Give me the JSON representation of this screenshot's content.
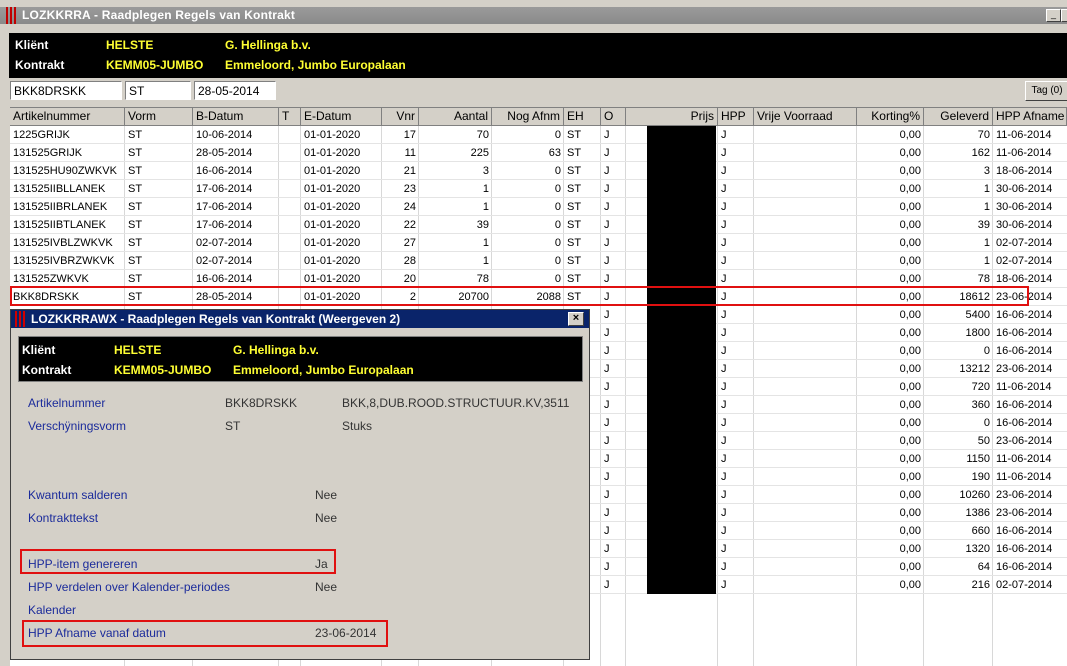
{
  "window": {
    "title": "LOZKKRRA - Raadplegen Regels van Kontrakt",
    "minimize_label": "_",
    "close_label": "×"
  },
  "header": {
    "klient_label": "Kliënt",
    "klient_code": "HELSTE",
    "klient_name": "G. Hellinga b.v.",
    "kontrakt_label": "Kontrakt",
    "kontrakt_code": "KEMM05-JUMBO",
    "kontrakt_desc": "Emmeloord, Jumbo Europalaan"
  },
  "filters": {
    "artikel": "BKK8DRSKK",
    "vorm": "ST",
    "datum": "28-05-2014",
    "tag_button": "Tag (0)"
  },
  "columns": [
    "Artikelnummer",
    "Vorm",
    "B-Datum",
    "T",
    "E-Datum",
    "Vnr",
    "Aantal",
    "Nog Afnm",
    "EH",
    "O",
    "Prijs",
    "HPP",
    "Vrije Voorraad",
    "Korting%",
    "Geleverd",
    "HPP Afname"
  ],
  "rows": [
    {
      "art": "1225GRIJK",
      "vorm": "ST",
      "bdat": "10-06-2014",
      "edat": "01-01-2020",
      "vnr": "17",
      "aantal": "70",
      "nog": "0",
      "eh": "ST",
      "o": "J",
      "hpp": "J",
      "korting": "0,00",
      "geleverd": "70",
      "afname": "11-06-2014"
    },
    {
      "art": "131525GRIJK",
      "vorm": "ST",
      "bdat": "28-05-2014",
      "edat": "01-01-2020",
      "vnr": "11",
      "aantal": "225",
      "nog": "63",
      "eh": "ST",
      "o": "J",
      "hpp": "J",
      "korting": "0,00",
      "geleverd": "162",
      "afname": "11-06-2014"
    },
    {
      "art": "131525HU90ZWKVK",
      "vorm": "ST",
      "bdat": "16-06-2014",
      "edat": "01-01-2020",
      "vnr": "21",
      "aantal": "3",
      "nog": "0",
      "eh": "ST",
      "o": "J",
      "hpp": "J",
      "korting": "0,00",
      "geleverd": "3",
      "afname": "18-06-2014"
    },
    {
      "art": "131525IIBLLANEK",
      "vorm": "ST",
      "bdat": "17-06-2014",
      "edat": "01-01-2020",
      "vnr": "23",
      "aantal": "1",
      "nog": "0",
      "eh": "ST",
      "o": "J",
      "hpp": "J",
      "korting": "0,00",
      "geleverd": "1",
      "afname": "30-06-2014"
    },
    {
      "art": "131525IIBRLANEK",
      "vorm": "ST",
      "bdat": "17-06-2014",
      "edat": "01-01-2020",
      "vnr": "24",
      "aantal": "1",
      "nog": "0",
      "eh": "ST",
      "o": "J",
      "hpp": "J",
      "korting": "0,00",
      "geleverd": "1",
      "afname": "30-06-2014"
    },
    {
      "art": "131525IIBTLANEK",
      "vorm": "ST",
      "bdat": "17-06-2014",
      "edat": "01-01-2020",
      "vnr": "22",
      "aantal": "39",
      "nog": "0",
      "eh": "ST",
      "o": "J",
      "hpp": "J",
      "korting": "0,00",
      "geleverd": "39",
      "afname": "30-06-2014"
    },
    {
      "art": "131525IVBLZWKVK",
      "vorm": "ST",
      "bdat": "02-07-2014",
      "edat": "01-01-2020",
      "vnr": "27",
      "aantal": "1",
      "nog": "0",
      "eh": "ST",
      "o": "J",
      "hpp": "J",
      "korting": "0,00",
      "geleverd": "1",
      "afname": "02-07-2014"
    },
    {
      "art": "131525IVBRZWKVK",
      "vorm": "ST",
      "bdat": "02-07-2014",
      "edat": "01-01-2020",
      "vnr": "28",
      "aantal": "1",
      "nog": "0",
      "eh": "ST",
      "o": "J",
      "hpp": "J",
      "korting": "0,00",
      "geleverd": "1",
      "afname": "02-07-2014"
    },
    {
      "art": "131525ZWKVK",
      "vorm": "ST",
      "bdat": "16-06-2014",
      "edat": "01-01-2020",
      "vnr": "20",
      "aantal": "78",
      "nog": "0",
      "eh": "ST",
      "o": "J",
      "hpp": "J",
      "korting": "0,00",
      "geleverd": "78",
      "afname": "18-06-2014"
    },
    {
      "art": "BKK8DRSKK",
      "vorm": "ST",
      "bdat": "28-05-2014",
      "edat": "01-01-2020",
      "vnr": "2",
      "aantal": "20700",
      "nog": "2088",
      "eh": "ST",
      "o": "J",
      "hpp": "J",
      "korting": "0,00",
      "geleverd": "18612",
      "afname": "23-06-2014"
    },
    {
      "o": "J",
      "hpp": "J",
      "korting": "0,00",
      "geleverd": "5400",
      "afname": "16-06-2014"
    },
    {
      "o": "J",
      "hpp": "J",
      "korting": "0,00",
      "geleverd": "1800",
      "afname": "16-06-2014"
    },
    {
      "o": "J",
      "hpp": "J",
      "korting": "0,00",
      "geleverd": "0",
      "afname": "16-06-2014"
    },
    {
      "o": "J",
      "hpp": "J",
      "korting": "0,00",
      "geleverd": "13212",
      "afname": "23-06-2014"
    },
    {
      "o": "J",
      "hpp": "J",
      "korting": "0,00",
      "geleverd": "720",
      "afname": "11-06-2014"
    },
    {
      "o": "J",
      "hpp": "J",
      "korting": "0,00",
      "geleverd": "360",
      "afname": "16-06-2014"
    },
    {
      "o": "J",
      "hpp": "J",
      "korting": "0,00",
      "geleverd": "0",
      "afname": "16-06-2014"
    },
    {
      "o": "J",
      "hpp": "J",
      "korting": "0,00",
      "geleverd": "50",
      "afname": "23-06-2014"
    },
    {
      "o": "J",
      "hpp": "J",
      "korting": "0,00",
      "geleverd": "1150",
      "afname": "11-06-2014"
    },
    {
      "o": "J",
      "hpp": "J",
      "korting": "0,00",
      "geleverd": "190",
      "afname": "11-06-2014"
    },
    {
      "o": "J",
      "hpp": "J",
      "korting": "0,00",
      "geleverd": "10260",
      "afname": "23-06-2014"
    },
    {
      "o": "J",
      "hpp": "J",
      "korting": "0,00",
      "geleverd": "1386",
      "afname": "23-06-2014"
    },
    {
      "o": "J",
      "hpp": "J",
      "korting": "0,00",
      "geleverd": "660",
      "afname": "16-06-2014"
    },
    {
      "o": "J",
      "hpp": "J",
      "korting": "0,00",
      "geleverd": "1320",
      "afname": "16-06-2014"
    },
    {
      "o": "J",
      "hpp": "J",
      "korting": "0,00",
      "geleverd": "64",
      "afname": "16-06-2014"
    },
    {
      "o": "J",
      "hpp": "J",
      "korting": "0,00",
      "geleverd": "216",
      "afname": "02-07-2014"
    }
  ],
  "dialog": {
    "title": "LOZKKRRAWX - Raadplegen Regels van Kontrakt (Weergeven 2)",
    "close_label": "×",
    "klient_label": "Kliënt",
    "klient_code": "HELSTE",
    "klient_name": "G. Hellinga b.v.",
    "kontrakt_label": "Kontrakt",
    "kontrakt_code": "KEMM05-JUMBO",
    "kontrakt_desc": "Emmeloord, Jumbo Europalaan",
    "artikel_label": "Artikelnummer",
    "artikel_code": "BKK8DRSKK",
    "artikel_desc": "BKK,8,DUB.ROOD.STRUCTUUR.KV,3511",
    "vorm_label": "Verschÿningsvorm",
    "vorm_code": "ST",
    "vorm_desc": "Stuks",
    "kwantum_label": "Kwantum salderen",
    "kwantum_val": "Nee",
    "kontrakttekst_label": "Kontrakttekst",
    "kontrakttekst_val": "Nee",
    "hpp_item_label": "HPP-item genereren",
    "hpp_item_val": "Ja",
    "hpp_verdelen_label": "HPP verdelen over Kalender-periodes",
    "hpp_verdelen_val": "Nee",
    "kalender_label": "Kalender",
    "hpp_afname_label": "HPP Afname vanaf datum",
    "hpp_afname_val": "23-06-2014"
  },
  "colors": {
    "header_bg": "#000000",
    "yellow": "#ffff33",
    "label_blue": "#1b2b9b",
    "highlight_red": "#e01010",
    "dialog_title": "#0a246a"
  }
}
